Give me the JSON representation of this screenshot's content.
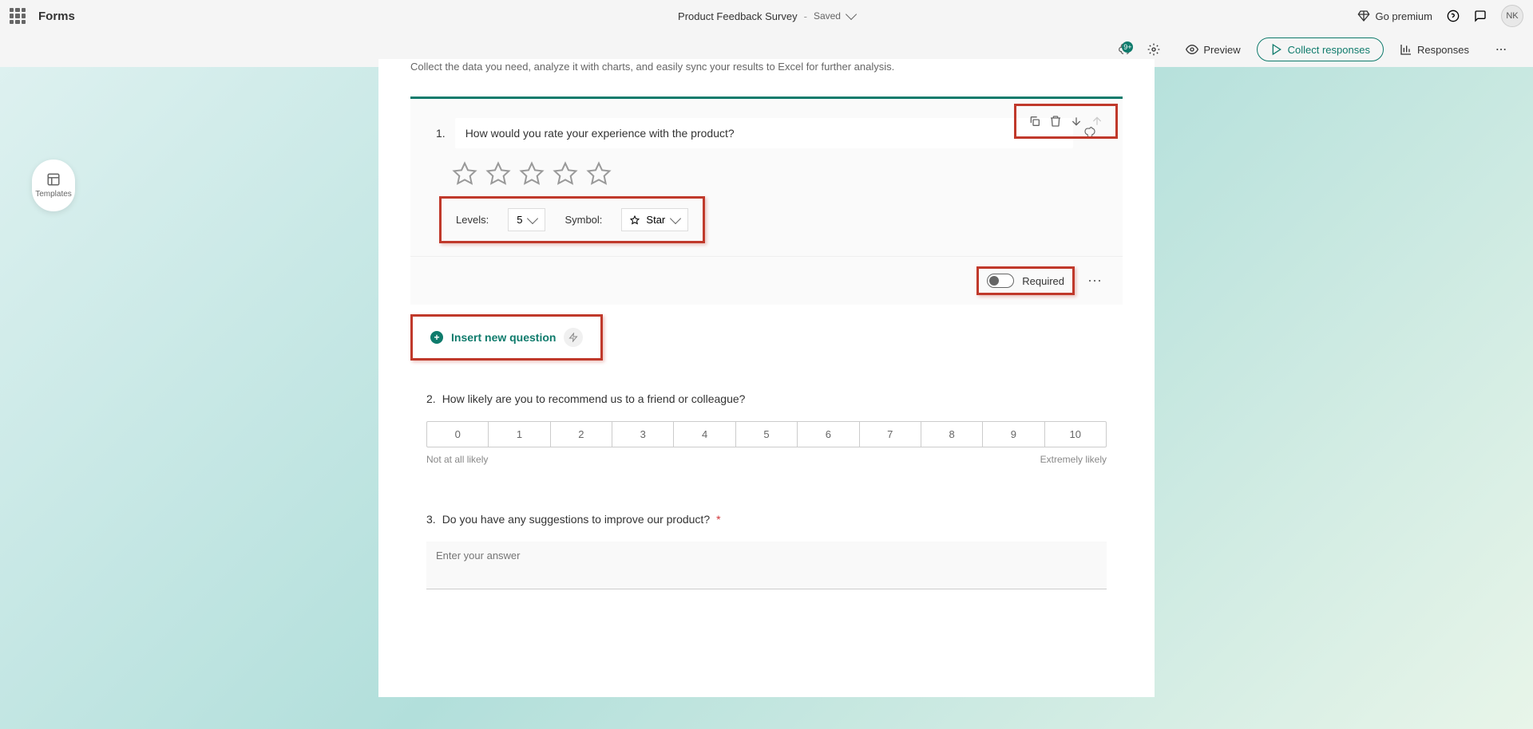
{
  "header": {
    "brand": "Forms",
    "doc_title": "Product Feedback Survey",
    "separator": "-",
    "save_status": "Saved",
    "go_premium": "Go premium",
    "avatar": "NK"
  },
  "toolbar": {
    "preview": "Preview",
    "collect": "Collect responses",
    "responses": "Responses",
    "notif_badge": "9+"
  },
  "templates": {
    "label": "Templates"
  },
  "form": {
    "description": "Collect the data you need, analyze it with charts, and easily sync your results to Excel for further analysis."
  },
  "q1": {
    "number": "1.",
    "text": "How would you rate your experience with the product?",
    "levels_label": "Levels:",
    "levels_value": "5",
    "symbol_label": "Symbol:",
    "symbol_value": "Star",
    "required_label": "Required"
  },
  "insert_new": {
    "label": "Insert new question"
  },
  "q2": {
    "number": "2.",
    "text": "How likely are you to recommend us to a friend or colleague?",
    "cells": [
      "0",
      "1",
      "2",
      "3",
      "4",
      "5",
      "6",
      "7",
      "8",
      "9",
      "10"
    ],
    "low": "Not at all likely",
    "high": "Extremely likely"
  },
  "q3": {
    "number": "3.",
    "text": "Do you have any suggestions to improve our product?",
    "required_mark": "*",
    "placeholder": "Enter your answer"
  }
}
